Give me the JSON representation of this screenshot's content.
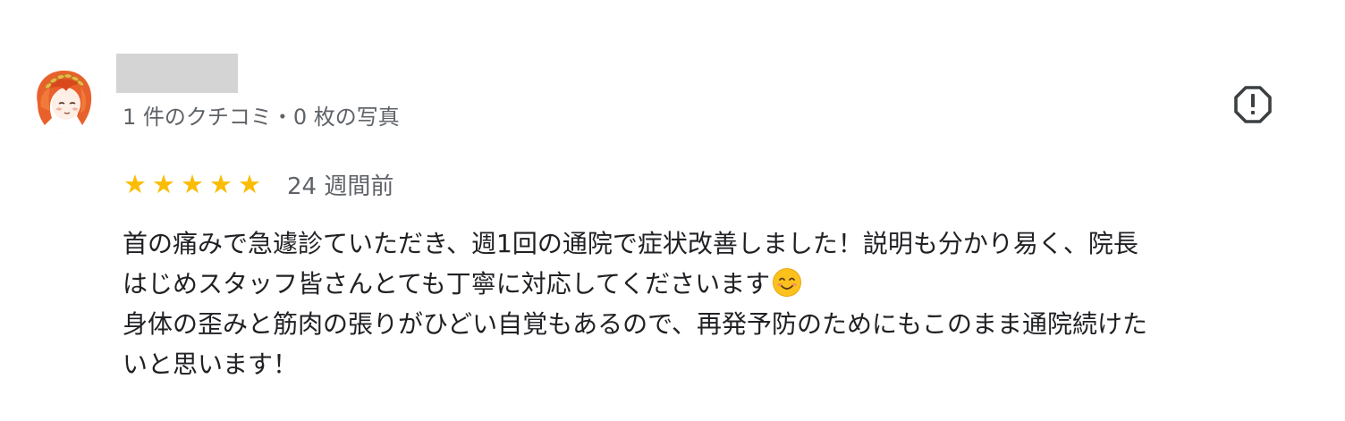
{
  "reviewer": {
    "avatar_icon": "reviewer-avatar",
    "name_redacted": true,
    "meta": "1 件のクチコミ・0 枚の写真"
  },
  "actions": {
    "report_icon": "alert-octagon-icon"
  },
  "rating": {
    "stars": 5,
    "max_stars": 5,
    "star_color": "#fbbc04",
    "date": "24 週間前"
  },
  "review": {
    "lines": [
      "首の痛みで急遽診ていただき、週1回の通院で症状改善しました！説明も分かり易く、院長",
      "はじめスタッフ皆さんとても丁寧に対応してくださいます",
      "身体の歪みと筋肉の張りがひどい自覚もあるので、再発予防のためにもこのまま通院続けた",
      "いと思います！"
    ],
    "emoji": "smiling-face-emoji"
  }
}
